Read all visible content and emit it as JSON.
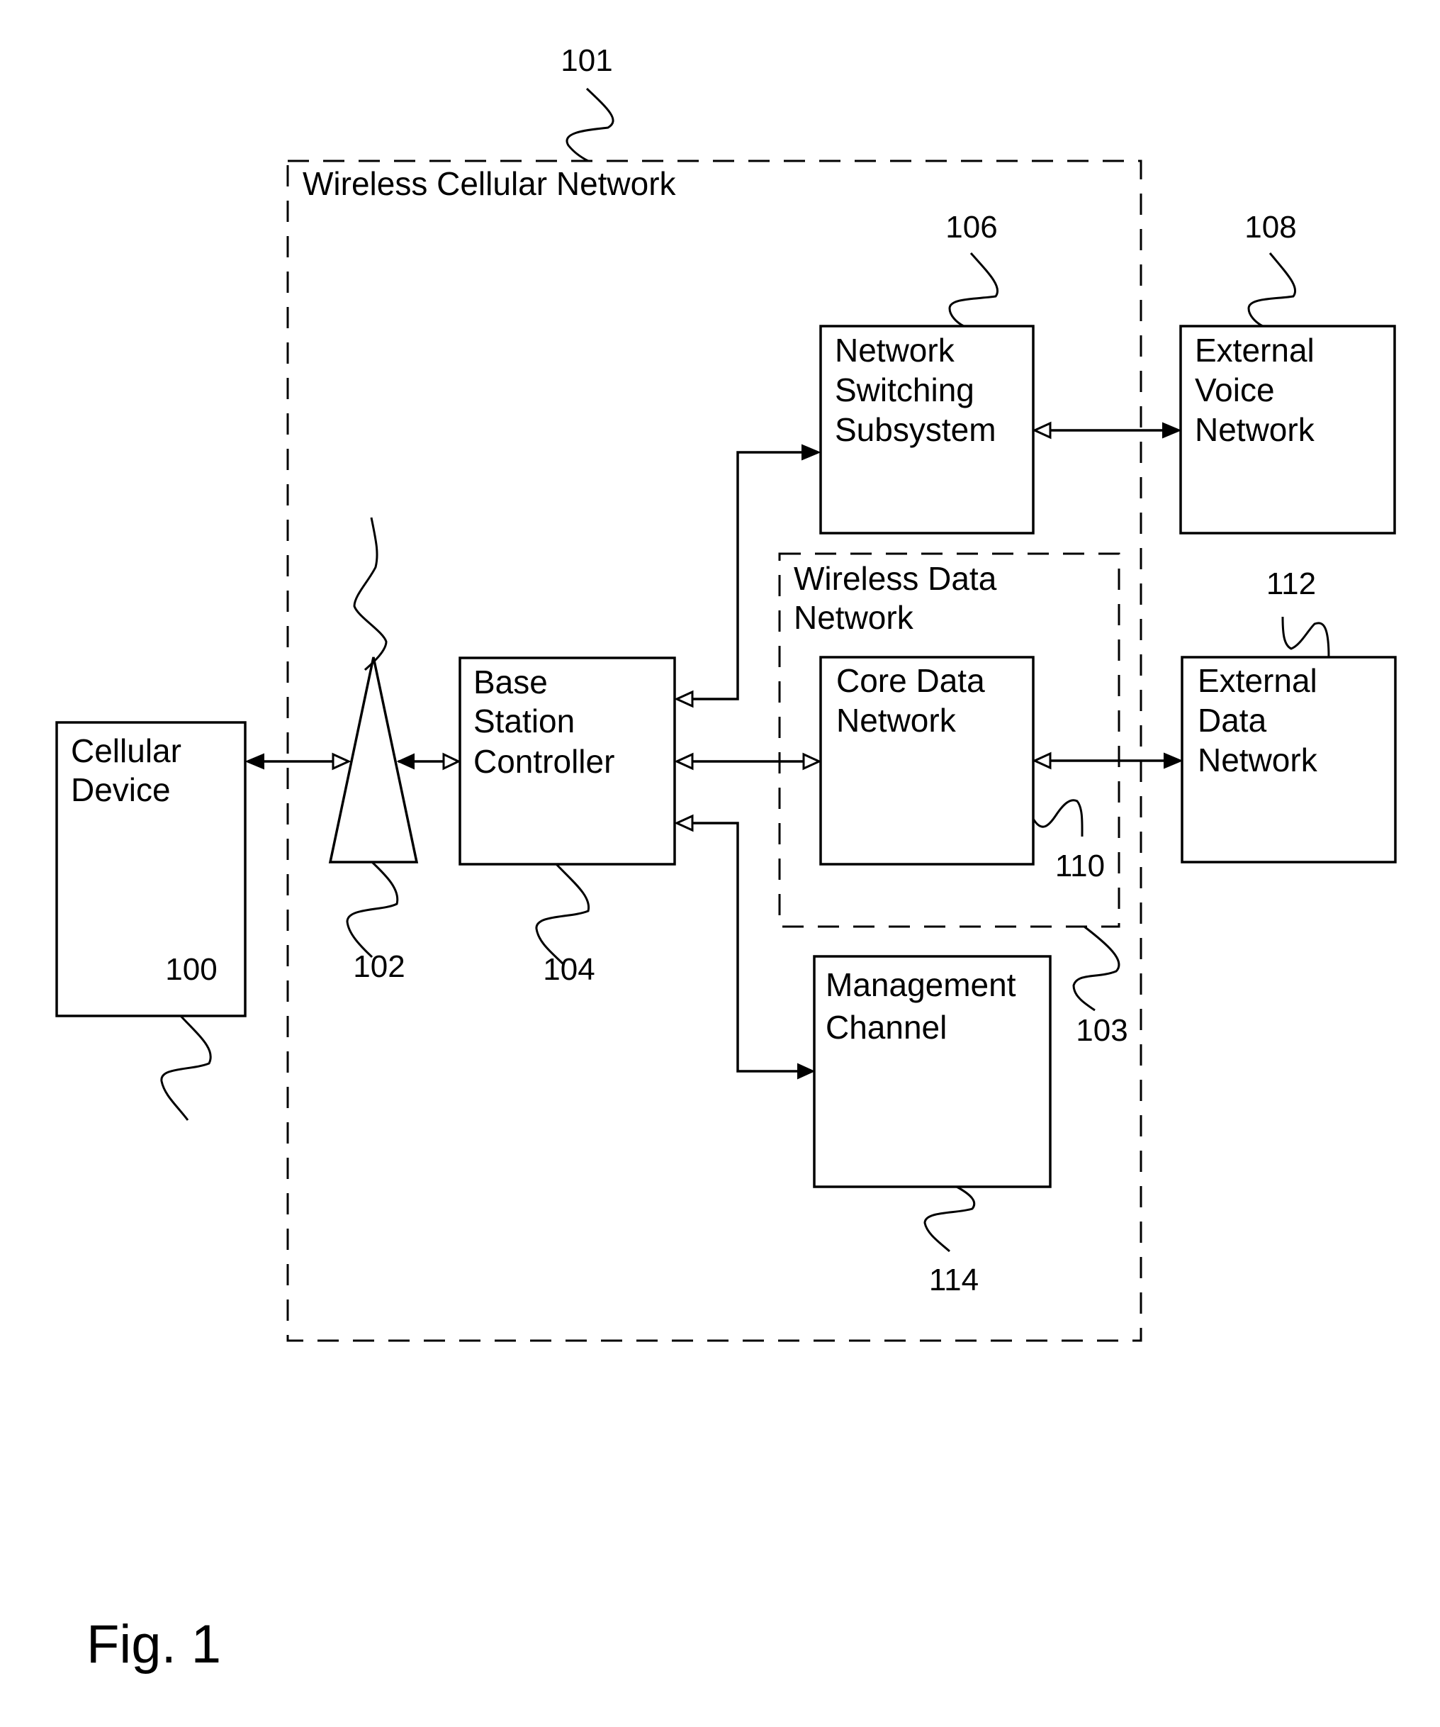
{
  "figure": {
    "caption": "Fig. 1",
    "containers": {
      "wireless_cellular_network": {
        "label": "Wireless Cellular Network",
        "ref": "101"
      },
      "wireless_data_network": {
        "label_line1": "Wireless Data",
        "label_line2": "Network",
        "ref": "103"
      }
    },
    "blocks": {
      "cellular_device": {
        "lines": [
          "Cellular",
          "Device"
        ],
        "ref": "100"
      },
      "antenna": {
        "ref": "102"
      },
      "base_station_controller": {
        "lines": [
          "Base",
          "Station",
          "Controller"
        ],
        "ref": "104"
      },
      "network_switching_subsystem": {
        "lines": [
          "Network",
          "Switching",
          "Subsystem"
        ],
        "ref": "106"
      },
      "external_voice_network": {
        "lines": [
          "External",
          "Voice",
          "Network"
        ],
        "ref": "108"
      },
      "core_data_network": {
        "lines": [
          "Core Data",
          "Network"
        ],
        "ref": "110"
      },
      "external_data_network": {
        "lines": [
          "External",
          "Data",
          "Network"
        ],
        "ref": "112"
      },
      "management_channel": {
        "lines": [
          "Management",
          "Channel"
        ],
        "ref": "114"
      }
    },
    "connections": [
      {
        "from": "Cellular Device",
        "to": "Antenna",
        "direction": "bidirectional"
      },
      {
        "from": "Antenna",
        "to": "Base Station Controller",
        "direction": "bidirectional"
      },
      {
        "from": "Base Station Controller",
        "to": "Network Switching Subsystem",
        "direction": "bidirectional"
      },
      {
        "from": "Base Station Controller",
        "to": "Core Data Network",
        "direction": "bidirectional"
      },
      {
        "from": "Base Station Controller",
        "to": "Management Channel",
        "direction": "bidirectional"
      },
      {
        "from": "Network Switching Subsystem",
        "to": "External Voice Network",
        "direction": "bidirectional"
      },
      {
        "from": "Core Data Network",
        "to": "External Data Network",
        "direction": "bidirectional"
      }
    ]
  }
}
